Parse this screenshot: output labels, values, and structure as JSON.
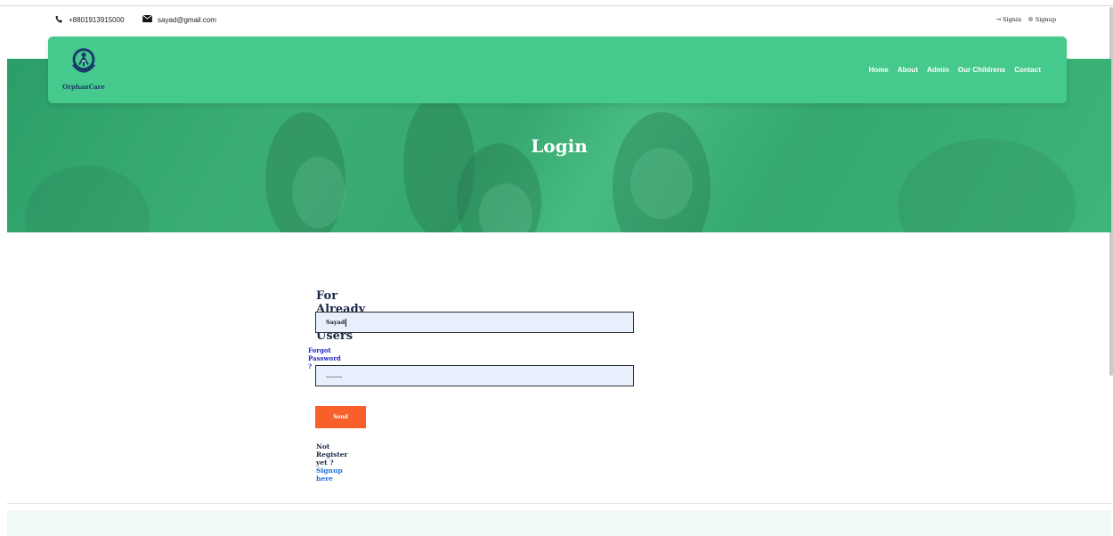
{
  "topbar": {
    "phone": "+8801913915000",
    "email": "sayad@gmail.com",
    "signin_label": "Signin",
    "signup_label": "Signup"
  },
  "navbar": {
    "brand": "OrphanCare",
    "links": [
      "Home",
      "About",
      "Admin",
      "Our Childrens",
      "Contact"
    ]
  },
  "hero": {
    "title": "Login"
  },
  "form": {
    "heading": "For Already Registered Users",
    "username_value": "Sayad",
    "forgot_label": "Forgot Password ?",
    "password_value": "........",
    "send_label": "Send",
    "register_prompt": "Not Register yet ?",
    "register_link": "Signup here"
  },
  "colors": {
    "brand_green": "#46c98d",
    "send_orange": "#f95f2b",
    "link_blue": "#1e6fd9",
    "input_bg": "#e8f0fe"
  },
  "icons": {
    "phone": "phone-icon",
    "email": "envelope-icon",
    "signin": "signin-icon",
    "signup": "registered-icon"
  }
}
